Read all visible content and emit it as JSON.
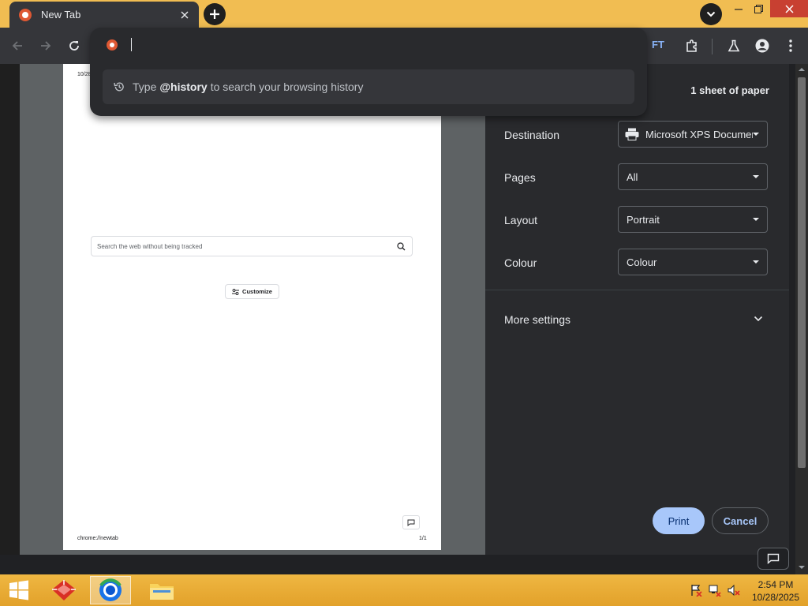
{
  "browser": {
    "tab_title": "New Tab",
    "ft_badge": "FT"
  },
  "omnibox": {
    "suggestion_prefix": "Type",
    "suggestion_keyword": "@history",
    "suggestion_suffix": "to search your browsing history"
  },
  "preview": {
    "date": "10/28/",
    "search_placeholder": "Search the web without being tracked",
    "customize_label": "Customize",
    "url": "chrome://newtab",
    "page_number": "1/1"
  },
  "print": {
    "sheet_count": "1 sheet of paper",
    "destination_label": "Destination",
    "destination_value": "Microsoft XPS Documer",
    "pages_label": "Pages",
    "pages_value": "All",
    "layout_label": "Layout",
    "layout_value": "Portrait",
    "colour_label": "Colour",
    "colour_value": "Colour",
    "more_settings": "More settings",
    "print_button": "Print",
    "cancel_button": "Cancel"
  },
  "taskbar": {
    "time": "2:54 PM",
    "date": "10/28/2025"
  },
  "colors": {
    "title_bar": "#f1bd52",
    "accent": "#a8c7fa",
    "panel": "#292a2d",
    "taskbar": "#e8a832"
  },
  "icons": [
    "close-icon",
    "plus-icon",
    "chevron-down-icon",
    "minimize-icon",
    "restore-icon",
    "back-icon",
    "forward-icon",
    "reload-icon",
    "extensions-icon",
    "labs-icon",
    "profile-icon",
    "menu-icon",
    "history-icon",
    "search-icon",
    "printer-icon",
    "feedback-icon",
    "windows-start-icon"
  ]
}
